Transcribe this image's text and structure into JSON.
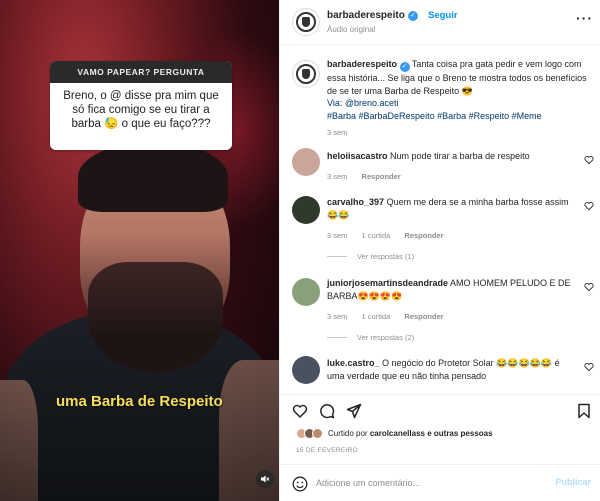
{
  "video": {
    "question_header": "VAMO PAPEAR? PERGUNTA",
    "question_text": "Breno, o @ disse pra mim que só fica comigo se eu tirar a barba 😓 o que eu faço???",
    "caption": "uma Barba de Respeito",
    "mute_icon": "speaker-muted-icon"
  },
  "post": {
    "account": "barbaderespeito",
    "follow_label": "Seguir",
    "audio_label": "Áudio original",
    "more_icon": "ellipsis-icon"
  },
  "caption": {
    "username": "barbaderespeito",
    "text": "Tanta coisa pra gata pedir e vem logo com essa história... Se liga que o Breno te mostra todos os benefícios de se ter uma Barba de Respeito 😎",
    "via": "Via: @breno.aceti",
    "hashtags": "#Barba #BarbaDeRespeito #Barba #Respeito #Meme",
    "time": "3 sem"
  },
  "comments": [
    {
      "username": "heloiisacastro",
      "text": "Num pode tirar a barba de respeito",
      "time": "3 sem",
      "likes": "",
      "reply": "Responder",
      "avatar_color": "#c9a59a"
    },
    {
      "username": "carvalho_397",
      "text": "Quem me dera se a minha barba fosse assim 😂😂",
      "time": "3 sem",
      "likes": "1 curtida",
      "reply": "Responder",
      "replies": "Ver respostas (1)",
      "avatar_color": "#2f3a2c"
    },
    {
      "username": "juniorjosemartinsdeandrade",
      "text": "AMO HOMEM PELUDO E DE BARBA😍😍😍😍",
      "time": "3 sem",
      "likes": "1 curtida",
      "reply": "Responder",
      "replies": "Ver respostas (2)",
      "avatar_color": "#8aa07a"
    },
    {
      "username": "luke.castro_",
      "text": "O negócio do Protetor Solar 😂😂😂😂😂 é uma verdade que eu não tinha pensado",
      "time": "",
      "likes": "",
      "reply": "",
      "avatar_color": "#4a5160"
    }
  ],
  "likes": {
    "liked_by": "Curtido por",
    "user": "carolcanellass",
    "others": "e outras pessoas",
    "avatar_colors": [
      "#d9a98f",
      "#7a5a4e",
      "#b98a6b"
    ]
  },
  "date": "15 DE FEVEREIRO",
  "add_comment": {
    "placeholder": "Adicione um comentário...",
    "publish": "Publicar"
  }
}
